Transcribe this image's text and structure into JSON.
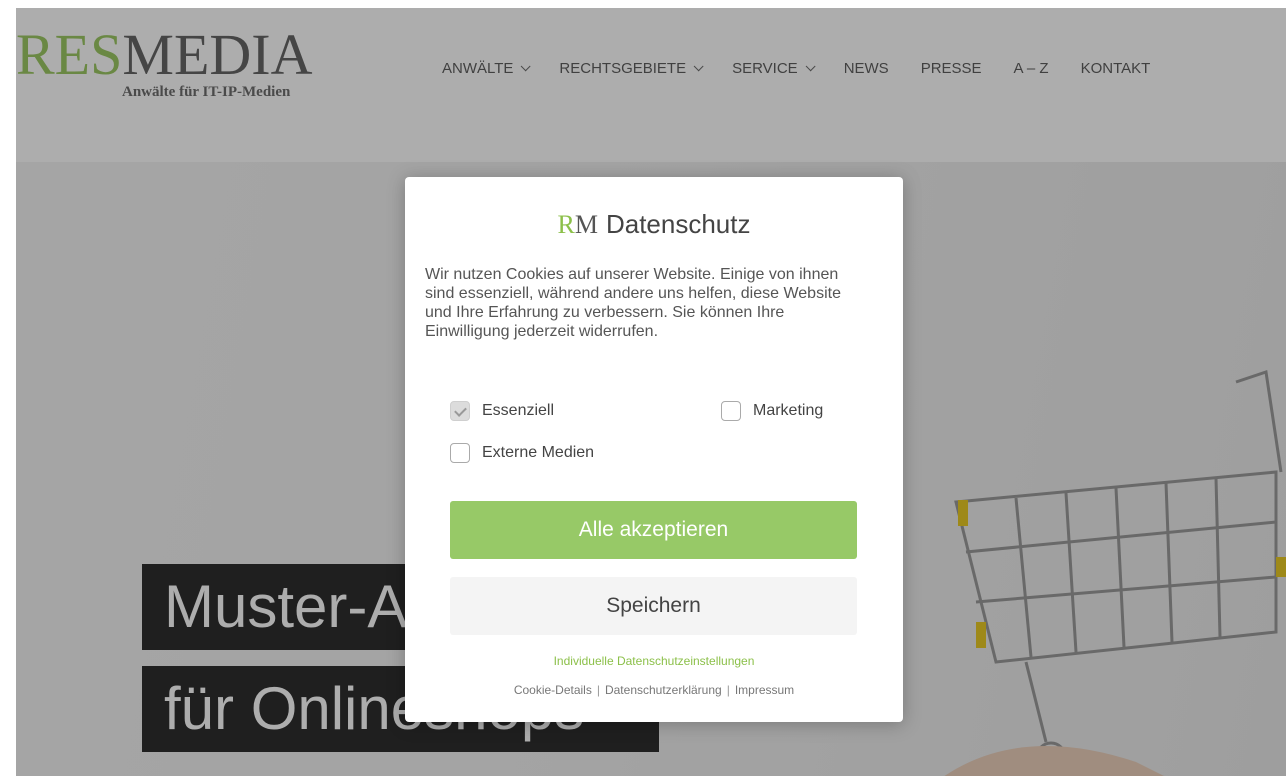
{
  "logo": {
    "part1": "RES",
    "part2": "MEDIA",
    "subtitle": "Anwälte für IT-IP-Medien"
  },
  "nav": [
    {
      "label": "ANWÄLTE"
    },
    {
      "label": "RECHTSGEBIETE"
    },
    {
      "label": "SERVICE"
    },
    {
      "label": "NEWS"
    },
    {
      "label": "PRESSE"
    },
    {
      "label": "A – Z"
    },
    {
      "label": "KONTAKT"
    }
  ],
  "hero": {
    "line1": "Muster-A",
    "line2": "für Onlineshops"
  },
  "modal": {
    "logo_r": "R",
    "logo_m": "M",
    "title": "Datenschutz",
    "text": "Wir nutzen Cookies auf unserer Website. Einige von ihnen sind essenziell, während andere uns helfen, diese Website und Ihre Erfahrung zu verbessern. Sie können Ihre Einwilligung jederzeit widerrufen.",
    "checkboxes": {
      "essential": "Essenziell",
      "marketing": "Marketing",
      "external": "Externe Medien"
    },
    "accept_all": "Alle akzeptieren",
    "save": "Speichern",
    "individual": "Individuelle Datenschutzeinstellungen",
    "footer": {
      "cookie_details": "Cookie-Details",
      "privacy": "Datenschutzerklärung",
      "imprint": "Impressum"
    }
  },
  "colors": {
    "brand_green": "#8cc04a",
    "button_green": "#97c967"
  }
}
